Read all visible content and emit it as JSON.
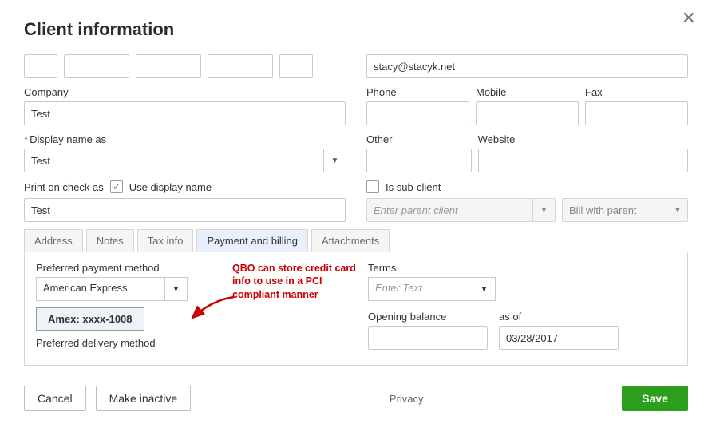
{
  "header": {
    "title": "Client information"
  },
  "left": {
    "company_label": "Company",
    "company_value": "Test",
    "display_name_label": "Display name as",
    "display_name_value": "Test",
    "print_check_label": "Print on check as",
    "use_display_name_label": "Use display name",
    "print_check_value": "Test"
  },
  "right": {
    "email_value": "stacy@stacyk.net",
    "phone_label": "Phone",
    "mobile_label": "Mobile",
    "fax_label": "Fax",
    "other_label": "Other",
    "website_label": "Website",
    "sub_client_label": "Is sub-client",
    "parent_placeholder": "Enter parent client",
    "bill_with_label": "Bill with parent"
  },
  "tabs": {
    "address": "Address",
    "notes": "Notes",
    "tax": "Tax info",
    "payment": "Payment and billing",
    "attachments": "Attachments"
  },
  "payment_tab": {
    "preferred_method_label": "Preferred payment method",
    "preferred_method_value": "American Express",
    "card_button": "Amex: xxxx-1008",
    "preferred_delivery_label": "Preferred delivery method",
    "terms_label": "Terms",
    "terms_placeholder": "Enter Text",
    "opening_balance_label": "Opening balance",
    "as_of_label": "as of",
    "as_of_value": "03/28/2017"
  },
  "annotation": {
    "line1": "QBO can store credit card",
    "line2": "info to use in a PCI",
    "line3": "compliant manner"
  },
  "footer": {
    "cancel": "Cancel",
    "make_inactive": "Make inactive",
    "privacy": "Privacy",
    "save": "Save"
  }
}
